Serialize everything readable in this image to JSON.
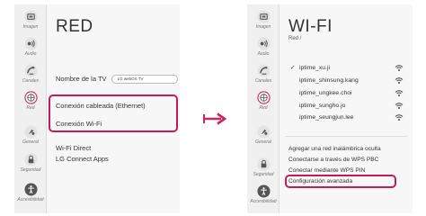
{
  "sidebar": {
    "items": [
      {
        "label": "Imagen",
        "icon": "picture-icon"
      },
      {
        "label": "Audio",
        "icon": "audio-icon"
      },
      {
        "label": "Canales",
        "icon": "channels-icon"
      },
      {
        "label": "Red",
        "icon": "network-icon",
        "active": true
      },
      {
        "label": "General",
        "icon": "general-icon"
      },
      {
        "label": "Seguridad",
        "icon": "lock-icon"
      },
      {
        "label": "Accesibilidad",
        "icon": "accessibility-icon"
      }
    ]
  },
  "left_screen": {
    "title": "RED",
    "tv_name_label": "Nombre de la TV",
    "tv_name_value": "LG webOS TV",
    "wired_connection": "Conexión cableada (Ethernet)",
    "wifi_connection": "Conexión Wi-Fi",
    "wifi_direct": "Wi-Fi Direct",
    "lg_connect_apps": "LG Connect Apps"
  },
  "right_screen": {
    "title": "WI-FI",
    "breadcrumb": "Red /",
    "networks": [
      {
        "name": "iptime_xu.ji",
        "connected": true
      },
      {
        "name": "iptime_shinsung.kang",
        "connected": false
      },
      {
        "name": "iptime_ungkee.choi",
        "connected": false
      },
      {
        "name": "iptime_sungho.jo",
        "connected": false
      },
      {
        "name": "iptime_seungjun.lee",
        "connected": false
      }
    ],
    "options": {
      "add_hidden": "Agregar una red inalámbrica oculta",
      "wps_pbc": "Conectarse a través de WPS PBC",
      "wps_pin": "Conectar mediante WPS PIN",
      "advanced": "Configuración avanzada"
    }
  },
  "colors": {
    "highlight": "#c8175d",
    "arrow": "#d1245d"
  }
}
